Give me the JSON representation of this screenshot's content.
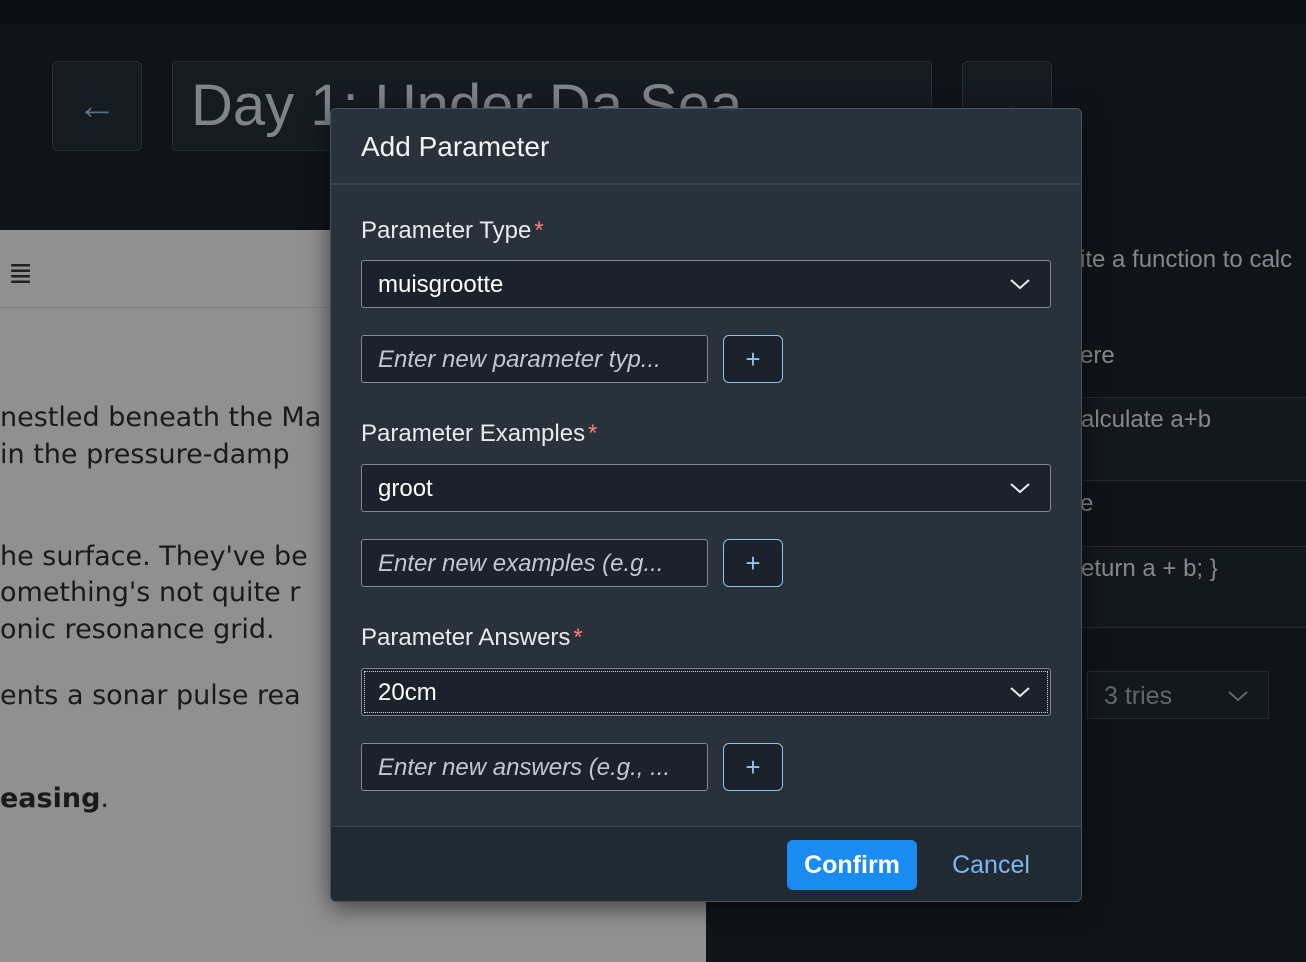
{
  "page": {
    "title": "Day 1: Under Da Sea",
    "back_glyph": "←",
    "forward_glyph": "→"
  },
  "story": {
    "menu_glyph": "≣",
    "lines": [
      "nestled beneath the Ma",
      " in the pressure-damp",
      "he surface. They've be",
      "omething's not quite r",
      "onic resonance grid.",
      "ents a sonar pulse rea"
    ],
    "bold_text": "easing",
    "bold_suffix": "."
  },
  "right_pane": {
    "prompt_fragment": "ite a function to calc",
    "label_1_fragment": "ere",
    "description_fragment": "alculate a+b",
    "label_2_fragment": "e",
    "code_fragment": "eturn a + b; }",
    "tries_value": "3 tries"
  },
  "dialog": {
    "title": "Add Parameter",
    "required_mark": "*",
    "type": {
      "label": "Parameter Type",
      "selected": "muisgrootte",
      "input_placeholder": "Enter new parameter typ...",
      "add_label": "+"
    },
    "examples": {
      "label": "Parameter Examples",
      "selected": "groot",
      "input_placeholder": "Enter new examples (e.g...",
      "add_label": "+"
    },
    "answers": {
      "label": "Parameter Answers",
      "selected": "20cm",
      "input_placeholder": "Enter new answers (e.g., ...",
      "add_label": "+"
    },
    "confirm_label": "Confirm",
    "cancel_label": "Cancel"
  },
  "icons": {
    "dropdown": "chevron-down-icon",
    "back": "arrow-left-icon",
    "forward": "arrow-right-icon",
    "menu": "menu-icon"
  },
  "colors": {
    "accent": "#1a8bf0",
    "required": "#ff7d7d",
    "dialog_bg": "#29313b",
    "page_bg": "#1b2129"
  }
}
